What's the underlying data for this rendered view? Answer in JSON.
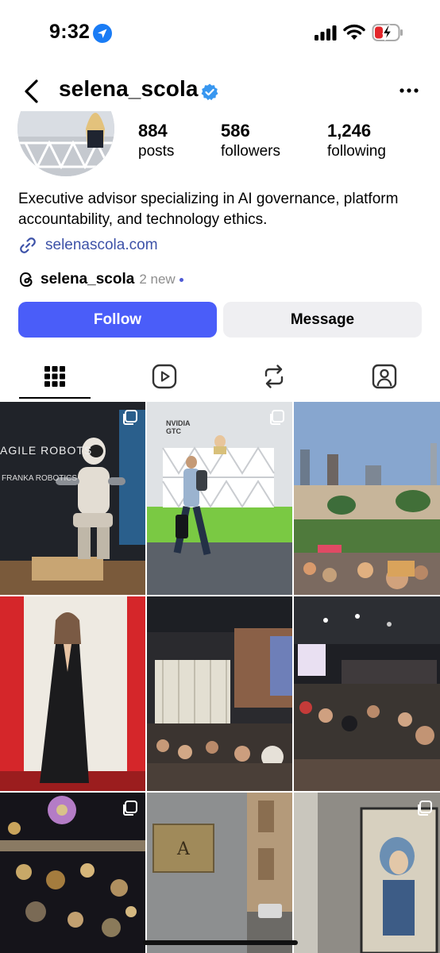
{
  "status_bar": {
    "time": "9:32",
    "icons": [
      "location-icon",
      "signal-icon",
      "wifi-icon",
      "battery-charging-icon"
    ]
  },
  "header": {
    "username": "selena_scola",
    "icons": [
      "back-icon",
      "verified-icon",
      "more-icon"
    ]
  },
  "stats": [
    {
      "value": "884",
      "label": "posts"
    },
    {
      "value": "586",
      "label": "followers"
    },
    {
      "value": "1,246",
      "label": "following"
    }
  ],
  "bio": "Executive advisor specializing in AI governance, platform accountability, and technology ethics.",
  "link": {
    "text": "selenascola.com",
    "icon": "link-icon"
  },
  "threads": {
    "name": "selena_scola",
    "new_text": "2 new",
    "icon": "threads-icon"
  },
  "buttons": {
    "follow": "Follow",
    "message": "Message"
  },
  "tabs": [
    "grid-icon",
    "reels-icon",
    "reposts-icon",
    "tagged-icon"
  ],
  "posts": [
    {
      "id": 1,
      "signage": [
        "AGILE ROBOTS",
        "FRANKA ROBOTICS"
      ],
      "multi": true
    },
    {
      "id": 2,
      "signage": [
        "NVIDIA GTC"
      ],
      "multi": true
    },
    {
      "id": 3,
      "multi": false
    },
    {
      "id": 4,
      "multi": false
    },
    {
      "id": 5,
      "multi": false
    },
    {
      "id": 6,
      "multi": false
    },
    {
      "id": 7,
      "multi": true
    },
    {
      "id": 8,
      "multi": false
    },
    {
      "id": 9,
      "multi": true
    }
  ],
  "colors": {
    "follow_button": "#4a5df9",
    "message_button": "#efeff2",
    "link": "#3d52a8",
    "verified": "#3897f0"
  }
}
